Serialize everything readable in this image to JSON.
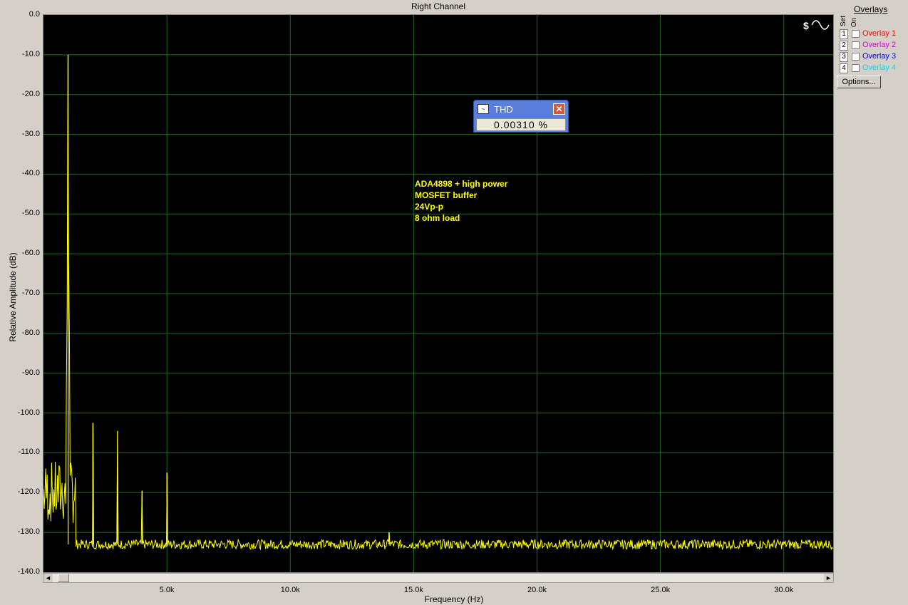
{
  "chart_data": {
    "type": "line",
    "title": "Right Channel",
    "xlabel": "Frequency (Hz)",
    "ylabel": "Relative Amplitude (dB)",
    "xlim": [
      0,
      32000
    ],
    "ylim": [
      -140,
      0
    ],
    "y_ticks": [
      "0.0",
      "-10.0",
      "-20.0",
      "-30.0",
      "-40.0",
      "-50.0",
      "-60.0",
      "-70.0",
      "-80.0",
      "-90.0",
      "-100.0",
      "-110.0",
      "-120.0",
      "-130.0",
      "-140.0"
    ],
    "x_ticks": [
      "5.0k",
      "10.0k",
      "15.0k",
      "20.0k",
      "25.0k",
      "30.0k"
    ],
    "grid": true,
    "series": [
      {
        "color": "#ffff00",
        "noise_floor_db": -133,
        "peaks": [
          {
            "x": 1000,
            "y": -10
          },
          {
            "x": 2000,
            "y": -102.5
          },
          {
            "x": 3000,
            "y": -104.5
          },
          {
            "x": 4000,
            "y": -119.5
          },
          {
            "x": 5000,
            "y": -115
          },
          {
            "x": 14000,
            "y": -130
          }
        ]
      }
    ],
    "annotations": [
      "ADA4898 + high power",
      "MOSFET buffer",
      "24Vp-p",
      "8 ohm load"
    ]
  },
  "thd": {
    "label": "THD",
    "value": "0.00310 %"
  },
  "overlays": {
    "title": "Overlays",
    "set_label": "Set",
    "on_label": "On",
    "items": [
      {
        "num": "1",
        "label": "Overlay 1",
        "color": "#ff0000"
      },
      {
        "num": "2",
        "label": "Overlay 2",
        "color": "#e000e0"
      },
      {
        "num": "3",
        "label": "Overlay 3",
        "color": "#0000ff"
      },
      {
        "num": "4",
        "label": "Overlay 4",
        "color": "#00d8ff"
      }
    ],
    "options_label": "Options..."
  },
  "scroll": {
    "left": "◄",
    "right": "►"
  }
}
